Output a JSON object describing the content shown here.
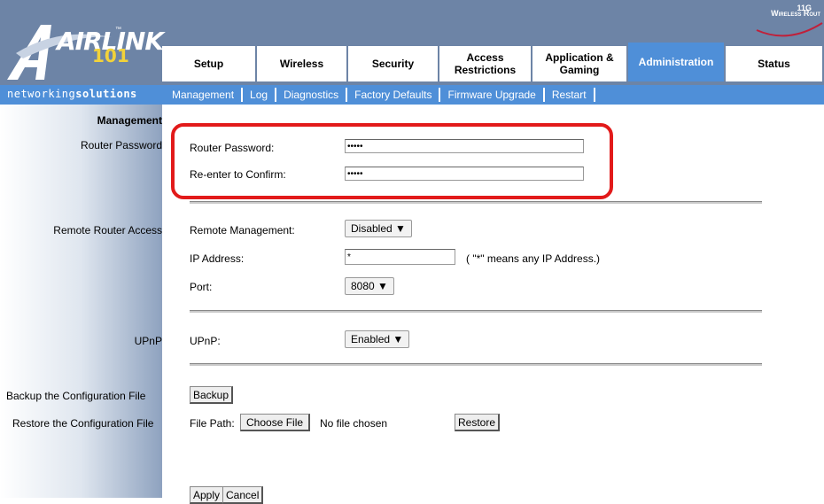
{
  "brand": {
    "logo_main": "AIRLINK",
    "logo_tm": "™",
    "logo_num": "101",
    "tagline_light": "networking",
    "tagline_bold": "solutions",
    "right_top": "11G",
    "right_text": "Wireless Rout"
  },
  "tabs": [
    {
      "label": "Setup"
    },
    {
      "label": "Wireless"
    },
    {
      "label": "Security"
    },
    {
      "label": "Access Restrictions"
    },
    {
      "label": "Application & Gaming"
    },
    {
      "label": "Administration",
      "active": true
    },
    {
      "label": "Status"
    }
  ],
  "subnav": [
    "Management",
    "Log",
    "Diagnostics",
    "Factory Defaults",
    "Firmware Upgrade",
    "Restart"
  ],
  "section_title": "Management",
  "router_password": {
    "section_label": "Router Password",
    "password_label": "Router Password:",
    "password_value": "•••••",
    "confirm_label": "Re-enter to Confirm:",
    "confirm_value": "•••••"
  },
  "remote_access": {
    "section_label": "Remote Router Access",
    "management_label": "Remote Management:",
    "management_value": "Disabled",
    "ip_label": "IP Address:",
    "ip_value": "*",
    "ip_hint": "( \"*\" means any IP Address.)",
    "port_label": "Port:",
    "port_value": "8080"
  },
  "upnp": {
    "section_label": "UPnP",
    "label": "UPnP:",
    "value": "Enabled"
  },
  "backup": {
    "section_label": "Backup the Configuration File",
    "button": "Backup"
  },
  "restore": {
    "section_label": "Restore the Configuration File",
    "file_path_label": "File Path:",
    "choose_button": "Choose File",
    "no_file": "No file chosen",
    "restore_button": "Restore"
  },
  "actions": {
    "apply": "Apply",
    "cancel": "Cancel"
  },
  "dropdown_arrow": "▼",
  "colors": {
    "header": "#6d84a6",
    "active_tab": "#4f8fd8",
    "highlight": "#e21a1a",
    "logo_accent": "#f2d23a"
  }
}
